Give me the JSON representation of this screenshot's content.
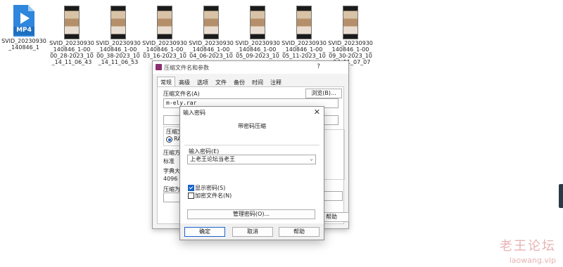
{
  "desktop": {
    "mp4_file": {
      "badge": "MP4",
      "name": "SVID_20230930_140846_1"
    },
    "video_files": [
      {
        "name": "SVID_20230930_140846_1-00_00_28-2023_10_14_11_06_43"
      },
      {
        "name": "SVID_20230930_140846_1-00_00_38-2023_10_14_11_06_53"
      },
      {
        "name": "SVID_20230930_140846_1-00_03_16-2023_10"
      },
      {
        "name": "SVID_20230930_140846_1-00_04_06-2023_10"
      },
      {
        "name": "SVID_20230930_140846_1-00_05_09-2023_10"
      },
      {
        "name": "SVID_20230930_140846_1-00_05_11-2023_10"
      },
      {
        "name": "SVID_20230930_140846_1-00_09_30-2023_10_14_11_07_07"
      }
    ]
  },
  "rar_window": {
    "title": "压缩文件名和参数",
    "help_q": "?",
    "tabs": [
      "常规",
      "高级",
      "选项",
      "文件",
      "备份",
      "时间",
      "注释"
    ],
    "archive_name_label": "压缩文件名(A)",
    "browse_button": "浏览(B)...",
    "archive_name_value": "m-ely.rar",
    "format_label": "压缩文",
    "format_radio": "RAR",
    "method_label": "压缩方",
    "method_value": "标准",
    "dict_label": "字典大",
    "dict_value": "4096 K",
    "split_label": "压缩为",
    "help_button": "帮助"
  },
  "password_dialog": {
    "title": "输入密码",
    "close": "✕",
    "heading": "带密码压缩",
    "enter_password_label": "输入密码(E)",
    "password_value": "上老王论坛当老王",
    "show_password_label": "显示密码(S)",
    "show_password_checked": true,
    "encrypt_filenames_label": "加密文件名(N)",
    "encrypt_filenames_checked": false,
    "manage_button": "管理密码(O)...",
    "ok_button": "确定",
    "cancel_button": "取消",
    "help_button": "帮助"
  },
  "watermark": {
    "text": "老王论坛",
    "url": "laowang.vip"
  },
  "colors": {
    "accent": "#1a64c8",
    "mp4_icon": "#2f86dd",
    "watermark": "#e7b3b3"
  }
}
